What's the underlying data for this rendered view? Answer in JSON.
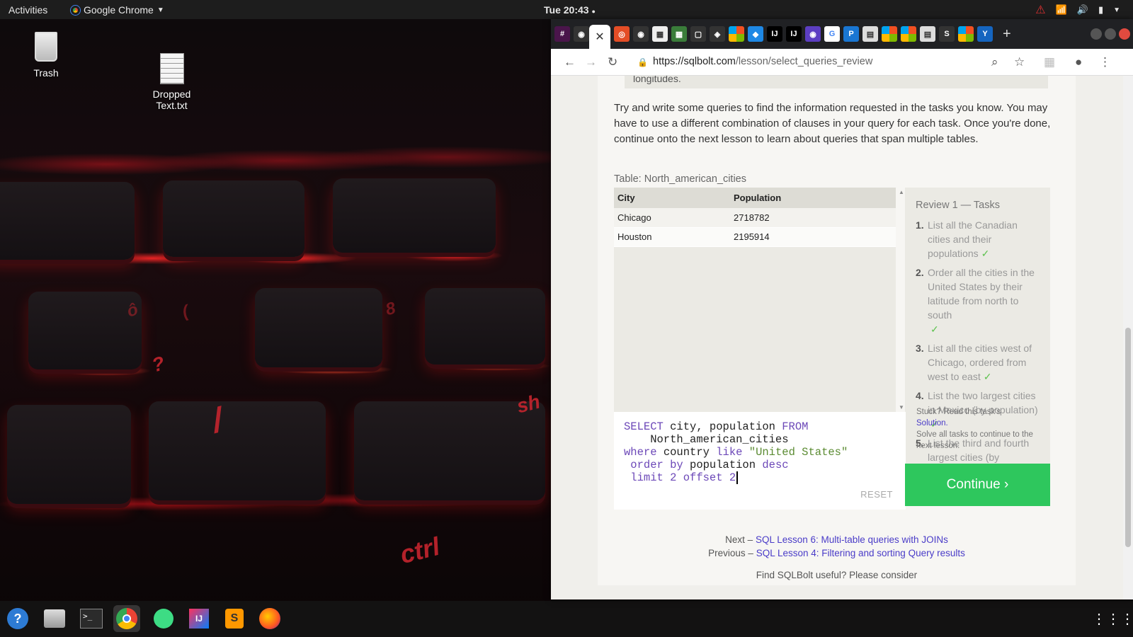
{
  "topbar": {
    "activities": "Activities",
    "app_name": "Google Chrome",
    "clock": "Tue 20:43"
  },
  "desktop": {
    "trash_label": "Trash",
    "file_label_line1": "Dropped",
    "file_label_line2": "Text.txt",
    "key_labels": [
      "?",
      "/",
      "sh",
      "ctrl",
      "ô",
      "8",
      "("
    ]
  },
  "browser": {
    "url_domain": "https://sqlbolt.com",
    "url_path": "/lesson/select_queries_review"
  },
  "page": {
    "intro": "Try and write some queries to find the information requested in the tasks you know. You may have to use a different combination of clauses in your query for each task. Once you're done, continue onto the next lesson to learn about queries that span multiple tables.",
    "prev_text": "longitudes.",
    "table_label": "Table: North_american_cities",
    "table": {
      "headers": [
        "City",
        "Population"
      ],
      "rows": [
        [
          "Chicago",
          "2718782"
        ],
        [
          "Houston",
          "2195914"
        ]
      ]
    },
    "reset": "RESET",
    "tasks_title": "Review 1 — Tasks",
    "tasks": [
      {
        "num": "1.",
        "text": "List all the Canadian cities and their populations",
        "done": "✓"
      },
      {
        "num": "2.",
        "text": "Order all the cities in the United States by their latitude from north to south",
        "done": "✓"
      },
      {
        "num": "3.",
        "text": "List all the cities west of Chicago, ordered from west to east",
        "done": "✓"
      },
      {
        "num": "4.",
        "text": "List the two largest cities in Mexico (by population)",
        "done": "✓"
      },
      {
        "num": "5.",
        "text": "List the third and fourth largest cities (by population) in the United States and their population",
        "done": ""
      }
    ],
    "stuck_text": "Stuck? Read this task's",
    "solution_link": "Solution.",
    "solve_text": "Solve all tasks to continue to the next lesson.",
    "continue_label": "Continue ›",
    "next_prefix": "Next –",
    "next_link": "SQL Lesson 6: Multi-table queries with JOINs",
    "prev_prefix": "Previous –",
    "prev_link": "SQL Lesson 4: Filtering and sorting Query results",
    "find_text": "Find SQLBolt useful? Please consider"
  },
  "query": {
    "select_kw": "SELECT",
    "cols": " city, population ",
    "from_kw": "FROM",
    "table": "    North_american_cities",
    "where_kw": "where",
    "where_mid": " country ",
    "like_kw": "like",
    "where_val": "\"United States\"",
    "order_kw": " order by",
    "order_col": " population ",
    "desc_kw": "desc",
    "limit_kw": " limit",
    "limit_val": " 2 ",
    "offset_kw": "offset",
    "offset_val": " 2"
  },
  "colors": {
    "continue_bg": "#2ec75d",
    "link": "#4a3cc8",
    "keyword": "#6c48b8",
    "string": "#5b8b32"
  }
}
